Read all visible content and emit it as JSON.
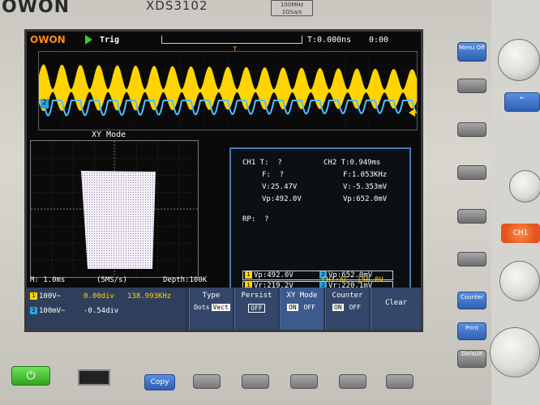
{
  "device": {
    "brand": "OWON",
    "model": "XDS3102",
    "spec": "100MHz\n1GSa/s"
  },
  "topbar": {
    "logo": "OWON",
    "trig_label": "Trig",
    "time_offset": "T:0.000ns",
    "time2": "0:00"
  },
  "xy_mode_title": "XY Mode",
  "measurements": {
    "ch1_t": "CH1 T:  ?",
    "ch1_f": "F:  ?",
    "ch1_v": "V:25.47V",
    "ch1_vp": "Vp:492.0V",
    "ch2_t": "CH2 T:0.949ms",
    "ch2_f": "F:1.053KHz",
    "ch2_v": "V:-5.353mV",
    "ch2_vp": "Vp:652.0mV",
    "rp": "RP:  ?",
    "box": {
      "ch1_vp": "Vp:492.0V",
      "ch2_vp": "Vp:652.0mV",
      "ch1_vr": "Vr:219.2V",
      "ch2_vr": "Vr:220.1mV"
    }
  },
  "status": {
    "m": "M: 1.0ms",
    "ms": "(5MS/s)",
    "depth": "Depth:100K",
    "trigger": "CH1:AC- ∫50.0V"
  },
  "channel_info": {
    "ch1_scale": "100V~",
    "ch1_offset": "0.00div",
    "ch1_freq": "138.993KHz",
    "ch2_scale": "100mV~",
    "ch2_offset": "-0.54div"
  },
  "menu": {
    "type": {
      "label": "Type",
      "opt1": "Dots",
      "opt2": "Vect"
    },
    "persist": {
      "label": "Persist",
      "opt": "OFF"
    },
    "xymode": {
      "label": "XY Mode",
      "on": "ON",
      "off": "OFF"
    },
    "counter": {
      "label": "Counter",
      "on": "ON",
      "off": "OFF"
    },
    "clear": {
      "label": "Clear"
    }
  },
  "side_buttons": {
    "menu_off": "Menu\nOff",
    "counter": "Counter",
    "print": "Print",
    "default": "Default",
    "ch1": "CH1",
    "copy": "Copy"
  },
  "colors": {
    "ch1": "#ffd400",
    "ch2": "#2aa4e0",
    "accent": "#ff8a1a"
  }
}
